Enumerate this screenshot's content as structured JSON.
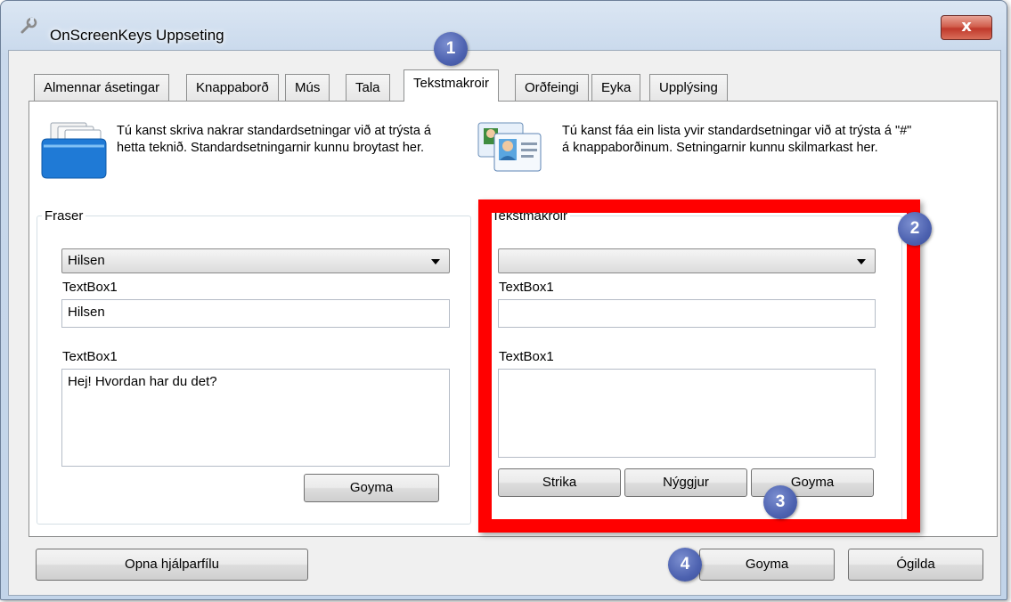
{
  "window": {
    "title": "OnScreenKeys Uppseting",
    "close_label": "x"
  },
  "tabs": [
    {
      "label": "Almennar ásetingar",
      "active": false
    },
    {
      "label": "Knappaborð",
      "active": false
    },
    {
      "label": "Mús",
      "active": false
    },
    {
      "label": "Tala",
      "active": false
    },
    {
      "label": "Tekstmakroir",
      "active": true
    },
    {
      "label": "Orðfeingi",
      "active": false
    },
    {
      "label": "Eyka",
      "active": false
    },
    {
      "label": "Upplýsing",
      "active": false
    }
  ],
  "left_panel": {
    "intro_icon": "folder-documents-icon",
    "intro_text": "Tú kanst skriva nakrar standardsetningar við at trýsta á hetta teknið. Standardsetningarnir kunnu broytast her.",
    "group_label": "Fraser",
    "combo_value": "Hilsen",
    "textbox1_label": "TextBox1",
    "textbox1_value": "Hilsen",
    "textbox2_label": "TextBox1",
    "textbox2_value": "Hej! Hvordan har du det?",
    "save_label": "Goyma"
  },
  "right_panel": {
    "intro_icon": "contact-cards-icon",
    "intro_text": "Tú kanst fáa ein lista yvir standardsetningar við at trýsta á \"#\" á knappaborðinum. Setningarnir kunnu skilmarkast her.",
    "group_label": "Tekstmakroir",
    "combo_value": "",
    "textbox1_label": "TextBox1",
    "textbox1_value": "",
    "textbox2_label": "TextBox1",
    "textbox2_value": "",
    "delete_label": "Strika",
    "new_label": "Nýggjur",
    "save_label": "Goyma"
  },
  "footer": {
    "help_label": "Opna hjálparfílu",
    "save_label": "Goyma",
    "cancel_label": "Ógilda"
  },
  "annotations": {
    "badge1": "1",
    "badge2": "2",
    "badge3": "3",
    "badge4": "4",
    "highlight_color": "#ff0000",
    "badge_color": "#4d62b0"
  }
}
